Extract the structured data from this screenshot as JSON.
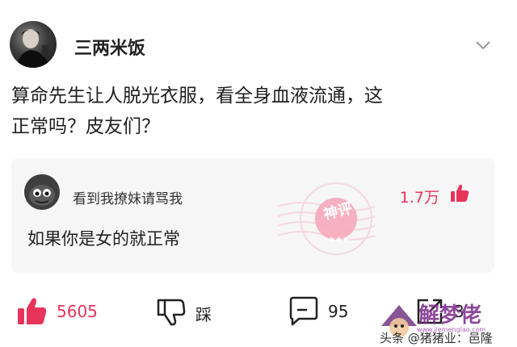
{
  "post": {
    "username": "三两米饭",
    "text_line1": "算命先生让人脱光衣服，看全身血液流通，这",
    "text_line2": "正常吗？皮友们？"
  },
  "comment": {
    "username": "看到我撩妹请骂我",
    "text": "如果你是女的就正常",
    "likes": "1.7万",
    "badge": "神评"
  },
  "actions": {
    "likes": "5605",
    "dislike_label": "踩",
    "comments": "95",
    "shares": "3"
  },
  "watermark": {
    "logo": "解梦佬",
    "url": "www.jiemenglao.com",
    "caption": "头条 @猪猪业：邑隆"
  },
  "colors": {
    "accent": "#e8335b",
    "comment_bg": "#f6f6f6",
    "text": "#1f1f1f"
  },
  "icons": {
    "post_menu": "chevron-down-icon",
    "like": "thumbs-up-icon",
    "dislike": "thumbs-down-icon",
    "comment": "comment-icon",
    "share": "share-icon"
  }
}
